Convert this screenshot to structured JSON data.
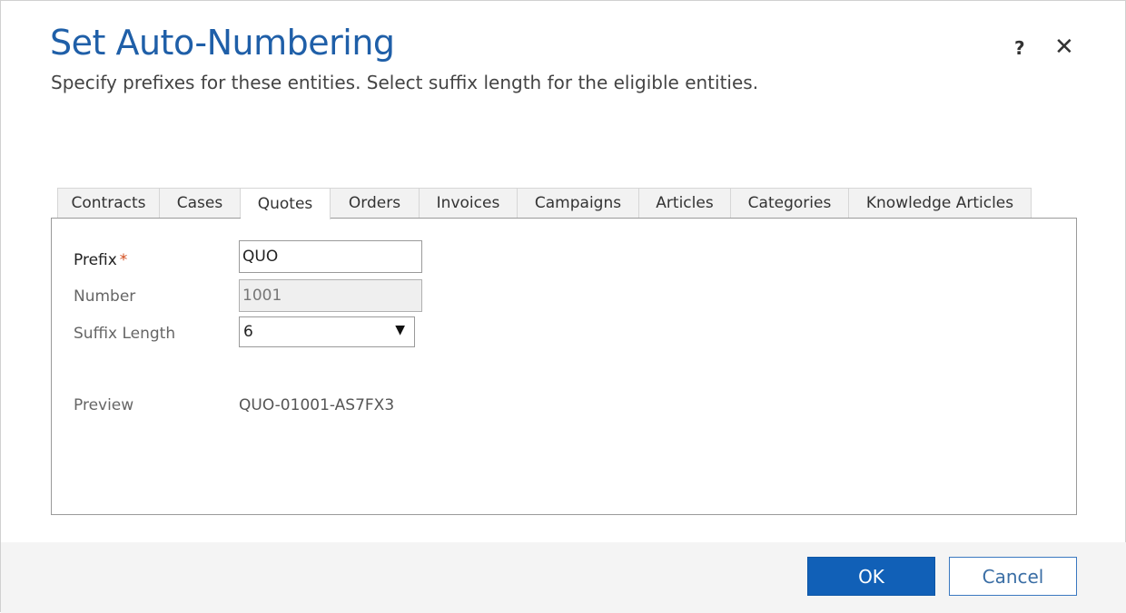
{
  "dialog": {
    "title": "Set Auto-Numbering",
    "subtitle": "Specify prefixes for these entities. Select suffix length for the eligible entities.",
    "help_label": "?",
    "close_label": "✕"
  },
  "tabs": [
    {
      "label": "Contracts",
      "active": false
    },
    {
      "label": "Cases",
      "active": false
    },
    {
      "label": "Quotes",
      "active": true
    },
    {
      "label": "Orders",
      "active": false
    },
    {
      "label": "Invoices",
      "active": false
    },
    {
      "label": "Campaigns",
      "active": false
    },
    {
      "label": "Articles",
      "active": false
    },
    {
      "label": "Categories",
      "active": false
    },
    {
      "label": "Knowledge Articles",
      "active": false
    }
  ],
  "form": {
    "prefix_label": "Prefix",
    "required_mark": "*",
    "prefix_value": "QUO",
    "number_label": "Number",
    "number_value": "1001",
    "suffix_label": "Suffix Length",
    "suffix_value": "6",
    "preview_label": "Preview",
    "preview_value": "QUO-01001-AS7FX3"
  },
  "footer": {
    "ok_label": "OK",
    "cancel_label": "Cancel"
  },
  "colors": {
    "accent": "#1160b7",
    "title": "#1f5fa8",
    "required": "#d24a1a"
  }
}
